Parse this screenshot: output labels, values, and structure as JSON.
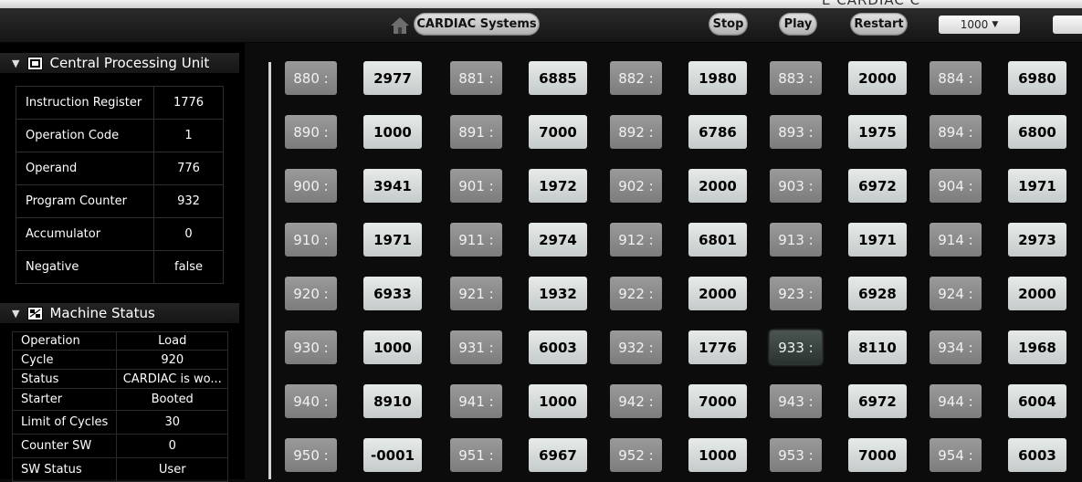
{
  "window": {
    "title": "E CARDIAC C"
  },
  "toolbar": {
    "home_label": "CARDIAC Systems",
    "stop_label": "Stop",
    "play_label": "Play",
    "restart_label": "Restart",
    "speed_value": "1000"
  },
  "cpu": {
    "title": "Central Processing Unit",
    "rows": [
      {
        "key": "Instruction Register",
        "value": "1776"
      },
      {
        "key": "Operation Code",
        "value": "1"
      },
      {
        "key": "Operand",
        "value": "776"
      },
      {
        "key": "Program Counter",
        "value": "932"
      },
      {
        "key": "Accumulator",
        "value": "0"
      },
      {
        "key": "Negative",
        "value": "false"
      }
    ]
  },
  "machine_status": {
    "title": "Machine Status",
    "rows": [
      {
        "key": "Operation",
        "value": "Load"
      },
      {
        "key": "Cycle",
        "value": "920"
      },
      {
        "key": "Status",
        "value": "CARDIAC is wo..."
      },
      {
        "key": "Starter",
        "value": "Booted"
      },
      {
        "key": "Limit of Cycles",
        "value": "30"
      },
      {
        "key": "Counter SW",
        "value": "0"
      },
      {
        "key": "SW Status",
        "value": "User"
      }
    ]
  },
  "memory": {
    "highlight_address": "933",
    "rows": [
      [
        {
          "a": "880 :",
          "v": "2977"
        },
        {
          "a": "881 :",
          "v": "6885"
        },
        {
          "a": "882 :",
          "v": "1980"
        },
        {
          "a": "883 :",
          "v": "2000"
        },
        {
          "a": "884 :",
          "v": "6980"
        }
      ],
      [
        {
          "a": "890 :",
          "v": "1000"
        },
        {
          "a": "891 :",
          "v": "7000"
        },
        {
          "a": "892 :",
          "v": "6786"
        },
        {
          "a": "893 :",
          "v": "1975"
        },
        {
          "a": "894 :",
          "v": "6800"
        }
      ],
      [
        {
          "a": "900 :",
          "v": "3941"
        },
        {
          "a": "901 :",
          "v": "1972"
        },
        {
          "a": "902 :",
          "v": "2000"
        },
        {
          "a": "903 :",
          "v": "6972"
        },
        {
          "a": "904 :",
          "v": "1971"
        }
      ],
      [
        {
          "a": "910 :",
          "v": "1971"
        },
        {
          "a": "911 :",
          "v": "2974"
        },
        {
          "a": "912 :",
          "v": "6801"
        },
        {
          "a": "913 :",
          "v": "1971"
        },
        {
          "a": "914 :",
          "v": "2973"
        }
      ],
      [
        {
          "a": "920 :",
          "v": "6933"
        },
        {
          "a": "921 :",
          "v": "1932"
        },
        {
          "a": "922 :",
          "v": "2000"
        },
        {
          "a": "923 :",
          "v": "6928"
        },
        {
          "a": "924 :",
          "v": "2000"
        }
      ],
      [
        {
          "a": "930 :",
          "v": "1000"
        },
        {
          "a": "931 :",
          "v": "6003"
        },
        {
          "a": "932 :",
          "v": "1776"
        },
        {
          "a": "933 :",
          "v": "8110"
        },
        {
          "a": "934 :",
          "v": "1968"
        }
      ],
      [
        {
          "a": "940 :",
          "v": "8910"
        },
        {
          "a": "941 :",
          "v": "1000"
        },
        {
          "a": "942 :",
          "v": "7000"
        },
        {
          "a": "943 :",
          "v": "6972"
        },
        {
          "a": "944 :",
          "v": "6004"
        }
      ],
      [
        {
          "a": "950 :",
          "v": "-0001"
        },
        {
          "a": "951 :",
          "v": "6967"
        },
        {
          "a": "952 :",
          "v": "1000"
        },
        {
          "a": "953 :",
          "v": "7000"
        },
        {
          "a": "954 :",
          "v": "6003"
        }
      ]
    ]
  }
}
